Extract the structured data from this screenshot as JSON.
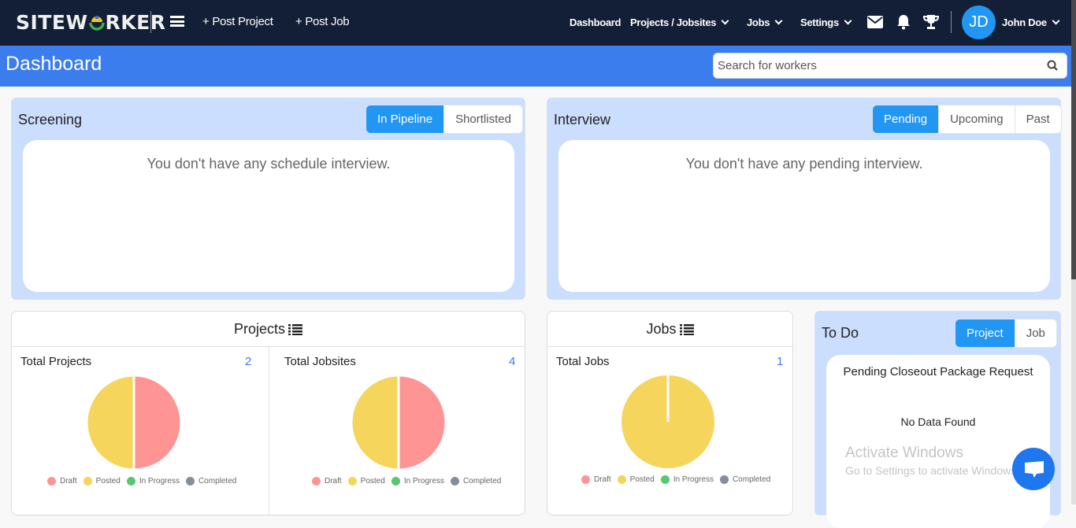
{
  "header": {
    "logo_prefix": "SITEW",
    "logo_suffix": "RKER",
    "post_project": "+ Post Project",
    "post_job": "+ Post Job",
    "nav": {
      "dashboard": "Dashboard",
      "projects": "Projects / Jobsites",
      "jobs": "Jobs",
      "settings": "Settings"
    },
    "user": {
      "initials": "JD",
      "name": "John Doe"
    }
  },
  "subheader": {
    "title": "Dashboard",
    "search_placeholder": "Search for workers"
  },
  "screening": {
    "title": "Screening",
    "tabs": [
      {
        "label": "In Pipeline",
        "active": true
      },
      {
        "label": "Shortlisted",
        "active": false
      }
    ],
    "empty_message": "You don't have any schedule interview."
  },
  "interview": {
    "title": "Interview",
    "tabs": [
      {
        "label": "Pending",
        "active": true
      },
      {
        "label": "Upcoming",
        "active": false
      },
      {
        "label": "Past",
        "active": false
      }
    ],
    "empty_message": "You don't have any pending interview."
  },
  "projects_card": {
    "title": "Projects",
    "total_projects_label": "Total Projects",
    "total_projects_value": "2",
    "total_jobsites_label": "Total Jobsites",
    "total_jobsites_value": "4"
  },
  "jobs_card": {
    "title": "Jobs",
    "total_jobs_label": "Total Jobs",
    "total_jobs_value": "1"
  },
  "todo": {
    "title": "To Do",
    "tabs": [
      {
        "label": "Project",
        "active": true
      },
      {
        "label": "Job",
        "active": false
      }
    ],
    "section_title": "Pending Closeout Package Request",
    "empty_message": "No Data Found"
  },
  "legend_labels": [
    "Draft",
    "Posted",
    "In Progress",
    "Completed"
  ],
  "colors": {
    "draft": "#ff9494",
    "posted": "#f6d55c",
    "in_progress": "#57c870",
    "completed": "#868e9c",
    "accent": "#2196f3",
    "header_bg": "#131f36",
    "subheader_bg": "#3b7ded"
  },
  "chart_data": [
    {
      "type": "pie",
      "title": "Total Projects",
      "categories": [
        "Draft",
        "Posted",
        "In Progress",
        "Completed"
      ],
      "values": [
        1,
        1,
        0,
        0
      ],
      "legend": "bottom"
    },
    {
      "type": "pie",
      "title": "Total Jobsites",
      "categories": [
        "Draft",
        "Posted",
        "In Progress",
        "Completed"
      ],
      "values": [
        2,
        2,
        0,
        0
      ],
      "legend": "bottom"
    },
    {
      "type": "pie",
      "title": "Total Jobs",
      "categories": [
        "Draft",
        "Posted",
        "In Progress",
        "Completed"
      ],
      "values": [
        0,
        1,
        0,
        0
      ],
      "legend": "bottom"
    }
  ],
  "watermark": {
    "line1": "Activate Windows",
    "line2": "Go to Settings to activate Windows."
  }
}
